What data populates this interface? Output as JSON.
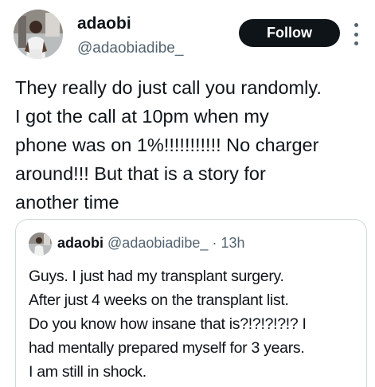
{
  "author": {
    "display_name": "adaobi",
    "handle": "@adaobiadibe_"
  },
  "actions": {
    "follow_label": "Follow",
    "more_icon": "more-vertical-icon"
  },
  "tweet": {
    "text": "They really do just call you randomly.\nI got the call at 10pm when my\nphone was on 1%!!!!!!!!!!! No charger\naround!!! But that is a story for\nanother time"
  },
  "quoted_tweet": {
    "display_name": "adaobi",
    "handle": "@adaobiadibe_",
    "separator": "·",
    "time": "13h",
    "text": "Guys. I just had my transplant surgery.\nAfter just 4 weeks on the transplant list.\nDo you know how insane that is?!?!?!?!? I\nhad mentally prepared myself for 3 years.\nI am still in shock."
  },
  "colors": {
    "text_primary": "#0f1419",
    "text_secondary": "#536471",
    "follow_bg": "#0f1419",
    "border": "#cfd9de"
  }
}
